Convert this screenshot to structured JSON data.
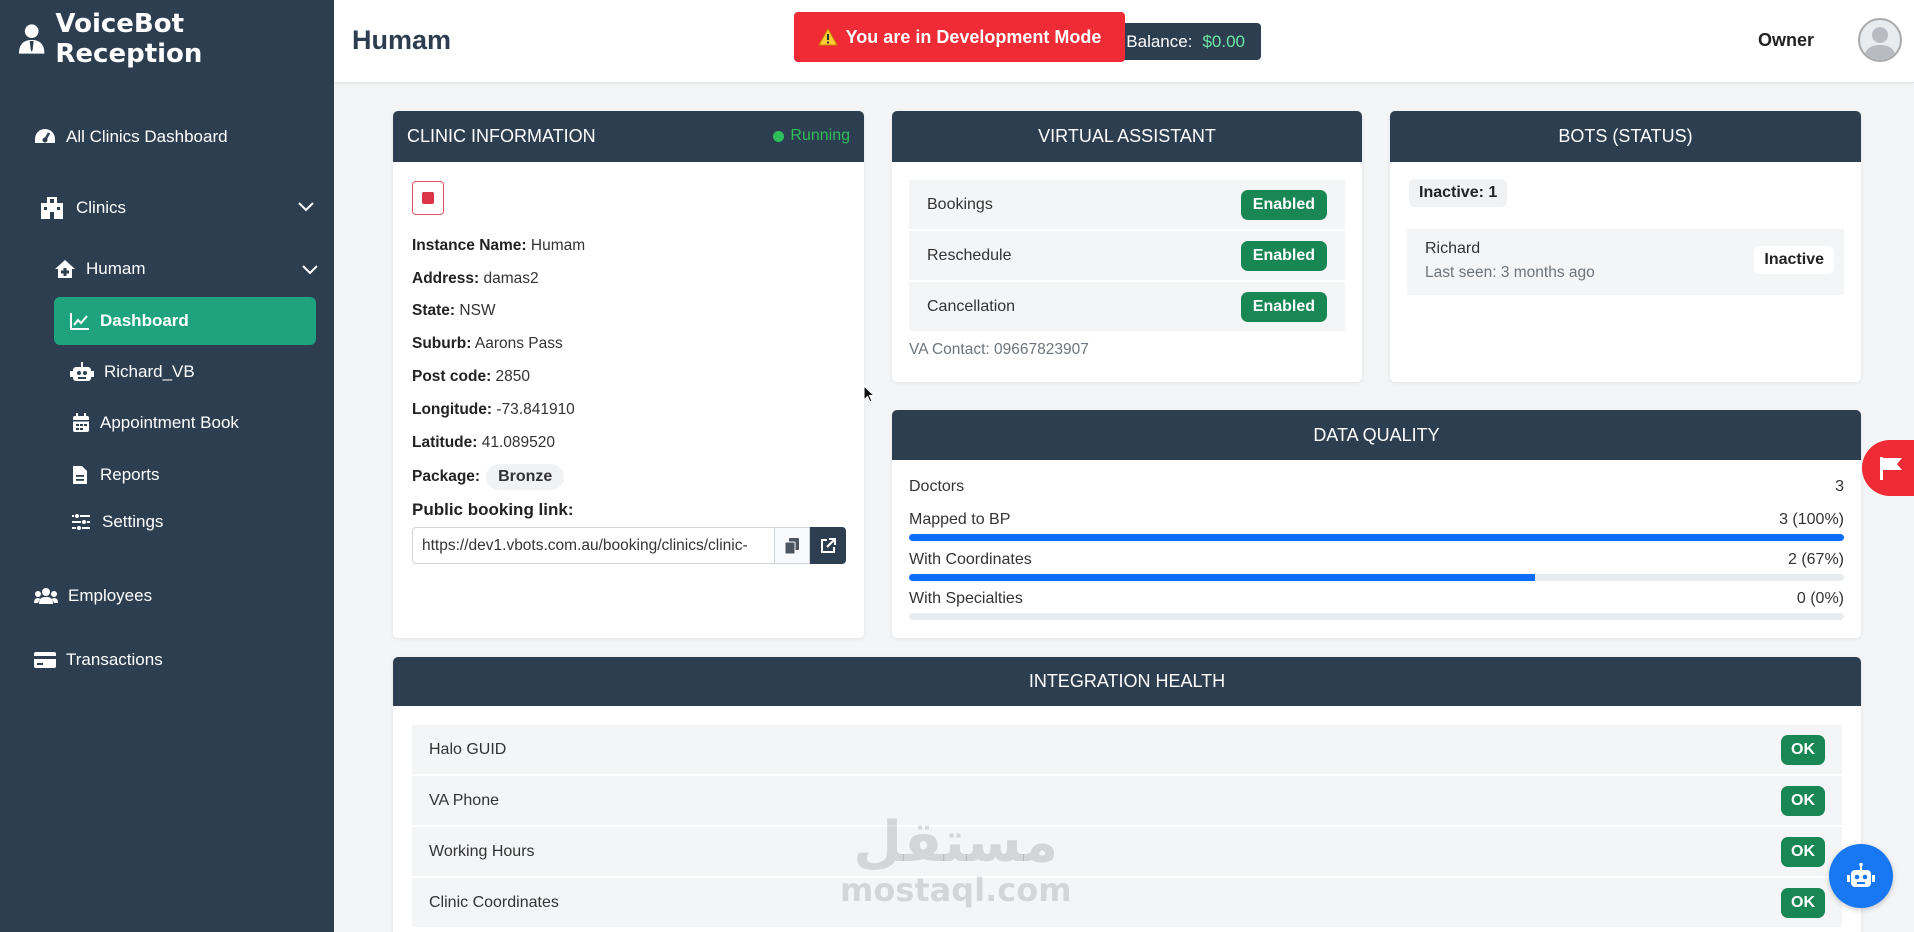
{
  "app": {
    "title": "VoiceBot Reception"
  },
  "sidebar": {
    "items": [
      {
        "label": "All Clinics Dashboard"
      },
      {
        "label": "Clinics"
      },
      {
        "label": "Humam"
      },
      {
        "label": "Dashboard"
      },
      {
        "label": "Richard_VB"
      },
      {
        "label": "Appointment Book"
      },
      {
        "label": "Reports"
      },
      {
        "label": "Settings"
      },
      {
        "label": "Employees"
      },
      {
        "label": "Transactions"
      }
    ]
  },
  "header": {
    "title": "Humam",
    "balance_label": "Balance:",
    "balance_value": "$0.00",
    "dev_banner": "You are in Development Mode",
    "user": "Owner"
  },
  "clinic_info": {
    "heading": "CLINIC INFORMATION",
    "status": "Running",
    "instance_label": "Instance Name:",
    "instance": "Humam",
    "address_label": "Address:",
    "address": "damas2",
    "state_label": "State:",
    "state": "NSW",
    "suburb_label": "Suburb:",
    "suburb": "Aarons Pass",
    "postcode_label": "Post code:",
    "postcode": "2850",
    "longitude_label": "Longitude:",
    "longitude": "-73.841910",
    "latitude_label": "Latitude:",
    "latitude": "41.089520",
    "package_label": "Package:",
    "package": "Bronze",
    "booking_label": "Public booking link:",
    "booking_url": "https://dev1.vbots.com.au/booking/clinics/clinic-"
  },
  "virtual_assistant": {
    "heading": "VIRTUAL ASSISTANT",
    "rows": [
      {
        "label": "Bookings",
        "status": "Enabled"
      },
      {
        "label": "Reschedule",
        "status": "Enabled"
      },
      {
        "label": "Cancellation",
        "status": "Enabled"
      }
    ],
    "contact": "VA Contact: 09667823907"
  },
  "bots": {
    "heading": "BOTS (STATUS)",
    "summary": "Inactive: 1",
    "bot_name": "Richard",
    "bot_seen": "Last seen: 3 months ago",
    "bot_status": "Inactive"
  },
  "data_quality": {
    "heading": "DATA QUALITY",
    "doctors_label": "Doctors",
    "doctors_value": "3",
    "rows": [
      {
        "label": "Mapped to BP",
        "value": "3 (100%)",
        "fraction": 1.0
      },
      {
        "label": "With Coordinates",
        "value": "2 (67%)",
        "fraction": 0.67
      },
      {
        "label": "With Specialties",
        "value": "0 (0%)",
        "fraction": 0.0
      }
    ]
  },
  "integration_health": {
    "heading": "INTEGRATION HEALTH",
    "rows": [
      {
        "label": "Halo GUID",
        "status": "OK"
      },
      {
        "label": "VA Phone",
        "status": "OK"
      },
      {
        "label": "Working Hours",
        "status": "OK"
      },
      {
        "label": "Clinic Coordinates",
        "status": "OK"
      }
    ]
  },
  "watermark": {
    "arabic": "مستقل",
    "latin": "mostaql.com"
  },
  "colors": {
    "sidebar": "#2c3e50",
    "accent": "#1fa37f",
    "success": "#198754",
    "danger": "#ef2b35",
    "progress": "#0d6efd"
  }
}
